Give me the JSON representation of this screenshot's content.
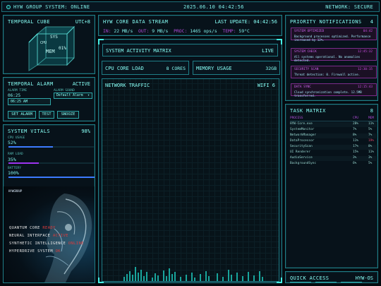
{
  "topbar": {
    "left": "HYW GROUP SYSTEM: ONLINE",
    "center": "2025.06.10 04:42:56",
    "right": "NETWORK: SECURE"
  },
  "cube": {
    "title": "TEMPORAL CUBE",
    "utc": "UTC+8",
    "words": [
      "MEM",
      "01%",
      "SYS",
      "CPU"
    ]
  },
  "alarm": {
    "title": "TEMPORAL ALARM",
    "status": "ACTIVE",
    "time_label": "ALARM TIME",
    "time_value": "06:25",
    "time_input": "06:25 AM",
    "sound_label": "ALARM SOUND",
    "sound_value": "Default Alarm",
    "buttons": [
      "SET ALARM",
      "TEST",
      "SNOOZE"
    ]
  },
  "vitals": {
    "title": "SYSTEM VITALS",
    "pct": "98%",
    "items": [
      {
        "label": "CPU USAGE",
        "value": "52%",
        "fraction": 0.52,
        "color": "#3c7bff"
      },
      {
        "label": "RAM LOAD",
        "value": "35%",
        "fraction": 0.35,
        "color": "#9c34f0"
      },
      {
        "label": "BATTERY",
        "value": "100%",
        "fraction": 1.0,
        "color": "#3c7bff"
      }
    ]
  },
  "hero": {
    "logo": "HYWGROUP",
    "lines": [
      {
        "label": "QUANTUM CORE",
        "status": "READY"
      },
      {
        "label": "NEURAL INTERFACE",
        "status": "ACTIVE"
      },
      {
        "label": "SYNTHETIC INTELLIGENCE",
        "status": "ONLINE"
      },
      {
        "label": "HYPERDRIVE SYSTEM",
        "status": "OK"
      }
    ]
  },
  "stream": {
    "title": "HYW CORE DATA STREAM",
    "update": "LAST UPDATE: 04:42:56",
    "in": "IN:",
    "in_v": "22 MB/s",
    "out": "OUT:",
    "out_v": "9 MB/s",
    "proc": "PROC:",
    "proc_v": "1465 ops/s",
    "temp": "TEMP:",
    "temp_v": "59°C"
  },
  "matrix": {
    "title": "SYSTEM ACTIVITY MATRIX",
    "status": "LIVE"
  },
  "cpu": {
    "title": "CPU CORE LOAD",
    "cores": "8 CORES"
  },
  "memory": {
    "title": "MEMORY USAGE",
    "size": "32GB"
  },
  "traffic": {
    "title": "NETWORK TRAFFIC",
    "net": "WIFI 6"
  },
  "notifications": {
    "title": "PRIORITY NOTIFICATIONS",
    "count": "4",
    "items": [
      {
        "head": "SYSTEM OPTIMIZED",
        "time": "04:42",
        "body": "Background processes optimized. Performance increased by 12%."
      },
      {
        "head": "SYSTEM CHECK",
        "time": "12:45:32",
        "body": "All systems operational. No anomalies detected."
      },
      {
        "head": "SECURITY SCAN",
        "time": "12:30:15",
        "body": "Threat detection: 0. Firewall active."
      },
      {
        "head": "DATA SYNC",
        "time": "12:15:43",
        "body": "Cloud synchronization complete. 12.5MB transferred."
      }
    ]
  },
  "tasks": {
    "title": "TASK MATRIX",
    "count": "8",
    "headers": [
      "PROCESS",
      "CPU",
      "MEM"
    ],
    "rows": [
      {
        "p": "HYW-Core.exe",
        "c": "28%",
        "m": "11%",
        "hot": false
      },
      {
        "p": "SystemMonitor",
        "c": "7%",
        "m": "5%",
        "hot": false
      },
      {
        "p": "NetworkManager",
        "c": "8%",
        "m": "7%",
        "hot": false
      },
      {
        "p": "DataProcessor",
        "c": "11%",
        "m": "19%",
        "hot": true
      },
      {
        "p": "SecurityScan",
        "c": "17%",
        "m": "8%",
        "hot": false
      },
      {
        "p": "UI Renderer",
        "c": "15%",
        "m": "11%",
        "hot": false
      },
      {
        "p": "AudioService",
        "c": "3%",
        "m": "3%",
        "hot": false
      },
      {
        "p": "BackgroundSync",
        "c": "6%",
        "m": "5%",
        "hot": false
      }
    ]
  },
  "quick": {
    "title": "QUICK ACCESS",
    "brand": "HYW-OS"
  }
}
